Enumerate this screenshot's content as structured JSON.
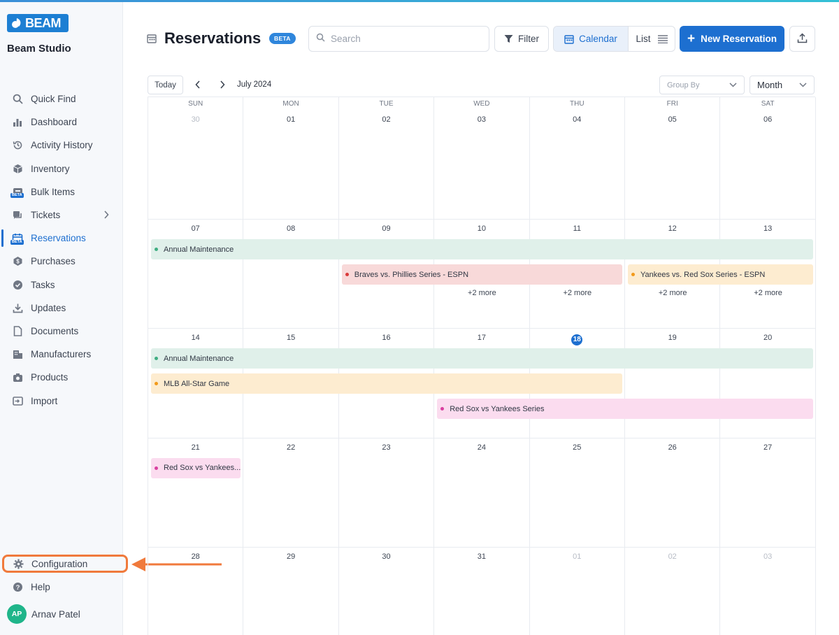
{
  "app": {
    "logo_text": "BEAM",
    "workspace": "Beam Studio"
  },
  "sidebar": {
    "items": [
      {
        "label": "Quick Find",
        "icon": "search-icon"
      },
      {
        "label": "Dashboard",
        "icon": "bar-chart-icon"
      },
      {
        "label": "Activity History",
        "icon": "history-icon"
      },
      {
        "label": "Inventory",
        "icon": "box-icon"
      },
      {
        "label": "Bulk Items",
        "icon": "bulk-items-beta-icon",
        "badge": "BETA"
      },
      {
        "label": "Tickets",
        "icon": "tickets-icon"
      },
      {
        "label": "Reservations",
        "icon": "calendar-beta-icon",
        "badge": "BETA",
        "active": true
      },
      {
        "label": "Purchases",
        "icon": "dollar-badge-icon"
      },
      {
        "label": "Tasks",
        "icon": "check-circle-icon"
      },
      {
        "label": "Updates",
        "icon": "download-icon"
      },
      {
        "label": "Documents",
        "icon": "document-icon"
      },
      {
        "label": "Manufacturers",
        "icon": "building-icon"
      },
      {
        "label": "Products",
        "icon": "camera-icon"
      },
      {
        "label": "Import",
        "icon": "import-icon"
      }
    ],
    "configuration": "Configuration",
    "help": "Help",
    "user": {
      "initials": "AP",
      "name": "Arnav Patel"
    }
  },
  "header": {
    "title": "Reservations",
    "beta_badge": "BETA",
    "search_placeholder": "Search",
    "filter_label": "Filter",
    "calendar_label": "Calendar",
    "list_label": "List",
    "new_reservation_label": "New Reservation"
  },
  "calendar": {
    "today_label": "Today",
    "month_label": "July 2024",
    "group_by_placeholder": "Group By",
    "view_select": "Month",
    "weekdays": [
      "SUN",
      "MON",
      "TUE",
      "WED",
      "THU",
      "FRI",
      "SAT"
    ],
    "weeks": [
      [
        "30",
        "01",
        "02",
        "03",
        "04",
        "05",
        "06"
      ],
      [
        "07",
        "08",
        "09",
        "10",
        "11",
        "12",
        "13"
      ],
      [
        "14",
        "15",
        "16",
        "17",
        "18",
        "19",
        "20"
      ],
      [
        "21",
        "22",
        "23",
        "24",
        "25",
        "26",
        "27"
      ],
      [
        "28",
        "29",
        "30",
        "31",
        "01",
        "02",
        "03"
      ]
    ],
    "muted_days": [
      [
        0,
        0
      ],
      [
        4,
        4
      ],
      [
        4,
        5
      ],
      [
        4,
        6
      ]
    ],
    "today": [
      2,
      4
    ],
    "events": [
      {
        "title": "Annual Maintenance",
        "week": 1,
        "start": 0,
        "end": 6,
        "lane": 0,
        "color": "#3fae82",
        "style": "green"
      },
      {
        "title": "Braves vs. Phillies Series - ESPN",
        "week": 1,
        "start": 2,
        "end": 4,
        "lane": 1,
        "color": "#d93a3a",
        "style": "red"
      },
      {
        "title": "Yankees vs. Red Sox Series - ESPN",
        "week": 1,
        "start": 5,
        "end": 6,
        "lane": 1,
        "color": "#f29a1a",
        "style": "orange"
      },
      {
        "title": "Annual Maintenance",
        "week": 2,
        "start": 0,
        "end": 6,
        "lane": 0,
        "color": "#3fae82",
        "style": "green"
      },
      {
        "title": "MLB All-Star Game",
        "week": 2,
        "start": 0,
        "end": 4,
        "lane": 1,
        "color": "#f29a1a",
        "style": "orange"
      },
      {
        "title": "Red Sox vs Yankees Series",
        "week": 2,
        "start": 3,
        "end": 6,
        "lane": 2,
        "color": "#d93fa0",
        "style": "pink"
      },
      {
        "title": "Red Sox vs Yankees...",
        "week": 3,
        "start": 0,
        "end": 0,
        "lane": 0,
        "color": "#d93fa0",
        "style": "pink"
      }
    ],
    "more_links": [
      {
        "week": 1,
        "day": 3,
        "label": "+2 more"
      },
      {
        "week": 1,
        "day": 4,
        "label": "+2 more"
      },
      {
        "week": 1,
        "day": 5,
        "label": "+2 more"
      },
      {
        "week": 1,
        "day": 6,
        "label": "+2 more"
      }
    ]
  }
}
